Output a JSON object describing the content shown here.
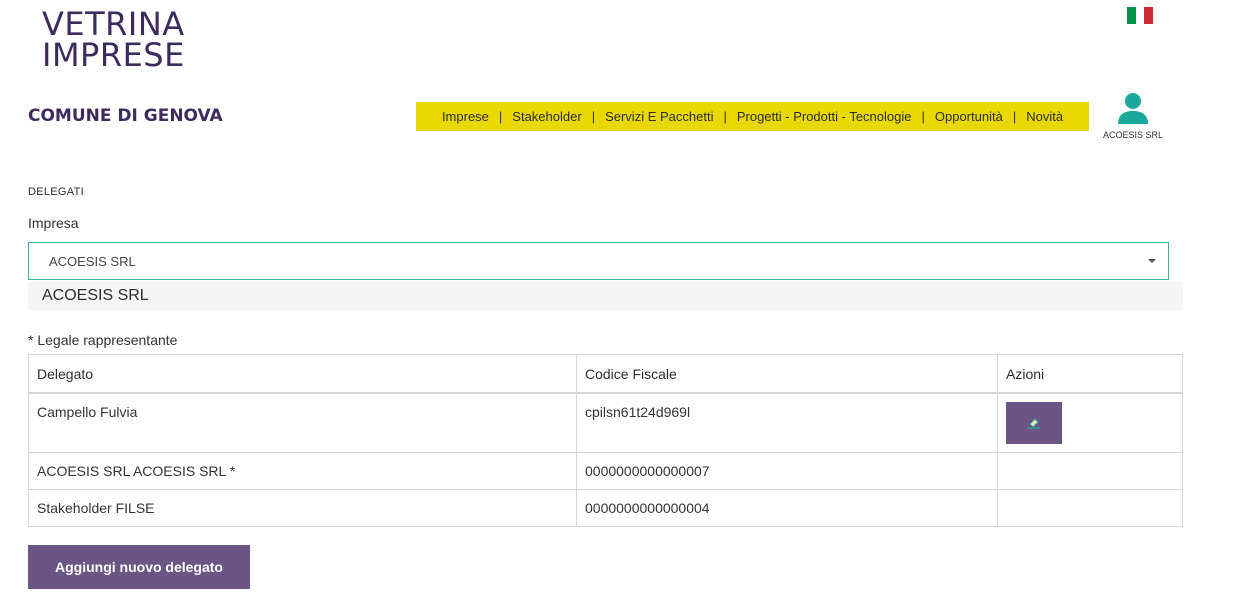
{
  "logo": {
    "line1": "VETRINA",
    "line2": "IMPRESE"
  },
  "flag_colors": [
    "#009246",
    "#ffffff",
    "#ce2b37"
  ],
  "comune_name": "COMUNE DI GENOVA",
  "nav": {
    "items": [
      "Imprese",
      "Stakeholder",
      "Servizi E Pacchetti",
      "Progetti - Prodotti - Tecnologie",
      "Opportunità",
      "Novità"
    ],
    "separator": "|",
    "bg_color": "#e8d800"
  },
  "user": {
    "icon": "user-icon",
    "name": "ACOESIS SRL",
    "icon_color": "#1aa99b"
  },
  "section_title": "DELEGATI",
  "impresa": {
    "label": "Impresa",
    "selected": "ACOESIS SRL",
    "dropdown_option": "ACOESIS SRL"
  },
  "legale_note": "* Legale rappresentante",
  "table": {
    "headers": [
      "Delegato",
      "Codice Fiscale",
      "Azioni"
    ],
    "rows": [
      {
        "delegato": "Campello Fulvia",
        "codice": "cpilsn61t24d969l",
        "action_icon": "edit-icon"
      },
      {
        "delegato": "ACOESIS SRL ACOESIS SRL *",
        "codice": "0000000000000007"
      },
      {
        "delegato": "Stakeholder FILSE",
        "codice": "0000000000000004"
      }
    ]
  },
  "add_button": "Aggiungi nuovo delegato",
  "accent_color": "#6b5584"
}
